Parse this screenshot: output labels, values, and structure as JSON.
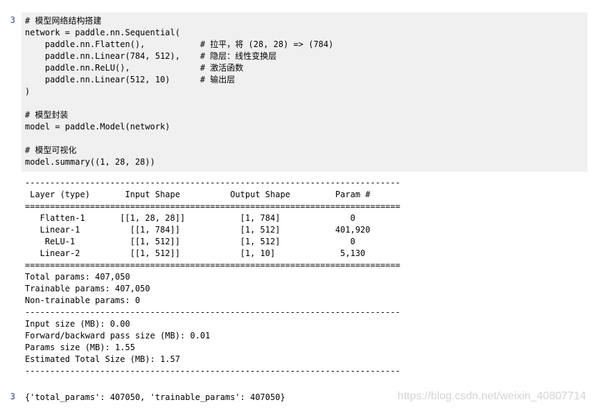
{
  "input_cell": {
    "prompt": "3",
    "lines": [
      "# 模型网络结构搭建",
      "network = paddle.nn.Sequential(",
      "    paddle.nn.Flatten(),           # 拉平，将 (28, 28) => (784)",
      "    paddle.nn.Linear(784, 512),    # 隐层：线性变换层",
      "    paddle.nn.ReLU(),              # 激活函数",
      "    paddle.nn.Linear(512, 10)      # 输出层",
      ")",
      "",
      "# 模型封装",
      "model = paddle.Model(network)",
      "",
      "# 模型可视化",
      "model.summary((1, 28, 28))"
    ]
  },
  "stdout": {
    "lines": [
      "---------------------------------------------------------------------------",
      " Layer (type)       Input Shape          Output Shape         Param #",
      "===========================================================================",
      "   Flatten-1       [[1, 28, 28]]           [1, 784]              0",
      "   Linear-1          [[1, 784]]            [1, 512]           401,920",
      "    ReLU-1           [[1, 512]]            [1, 512]              0",
      "   Linear-2          [[1, 512]]            [1, 10]             5,130",
      "===========================================================================",
      "Total params: 407,050",
      "Trainable params: 407,050",
      "Non-trainable params: 0",
      "---------------------------------------------------------------------------",
      "Input size (MB): 0.00",
      "Forward/backward pass size (MB): 0.01",
      "Params size (MB): 1.55",
      "Estimated Total Size (MB): 1.57",
      "---------------------------------------------------------------------------"
    ]
  },
  "output_cell": {
    "prompt": "3",
    "text": "{'total_params': 407050, 'trainable_params': 407050}"
  },
  "watermark": "https://blog.csdn.net/weixin_40807714",
  "colors": {
    "prompt": "#303f9f",
    "code_background": "#f0f0f0",
    "watermark": "#d4d4d4"
  }
}
